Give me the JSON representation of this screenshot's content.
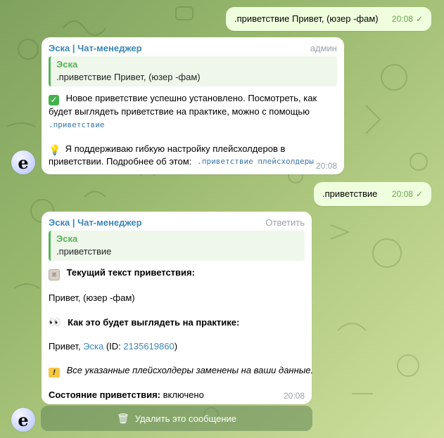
{
  "messages": {
    "m1": {
      "text": ".приветствие Привет, (юзер -фам)",
      "time": "20:08"
    },
    "m2": {
      "sender": "Эска | Чат-менеджер",
      "role": "админ",
      "quote_name": "Эска",
      "quote_text": ".приветствие Привет, (юзер -фам)",
      "line1": "Новое приветствие успешно установлено. Посмотреть, как",
      "line2": "будет выглядеть приветствие на практике, можно с помощью",
      "code1": ".приветствие",
      "line4": "Я поддерживаю гибкую настройку плейсхолдеров в",
      "line5": "приветствии. Подробнее об этом:",
      "code2": ".приветствие плейсхолдеры",
      "time": "20:08"
    },
    "m3": {
      "text": ".приветствие",
      "time": "20:08"
    },
    "m4": {
      "sender": "Эска | Чат-менеджер",
      "reply": "Ответить",
      "quote_name": "Эска",
      "quote_text": ".приветствие",
      "current_label": "Текущий текст приветствия:",
      "current_text": "Привет, (юзер -фам)",
      "practice_label": "Как это будет выглядеть на практике:",
      "practice_prefix": "Привет,",
      "practice_name": "Эска",
      "practice_id_open": "(ID:",
      "practice_id": "2135619860",
      "practice_id_close": ")",
      "warning": "Все указанные плейсхолдеры заменены на ваши данные.",
      "status_label": "Состояние приветствия:",
      "status_value": "включено",
      "time": "20:08"
    }
  },
  "delete_button": {
    "label": "Удалить это сообщение",
    "icon": "trash-icon"
  },
  "avatar": {
    "label": "e"
  },
  "colors": {
    "outgoing_bubble": "#efffde",
    "incoming_bubble": "#ffffff",
    "accent": "#3b86b3",
    "quote_green": "#58b35a"
  }
}
